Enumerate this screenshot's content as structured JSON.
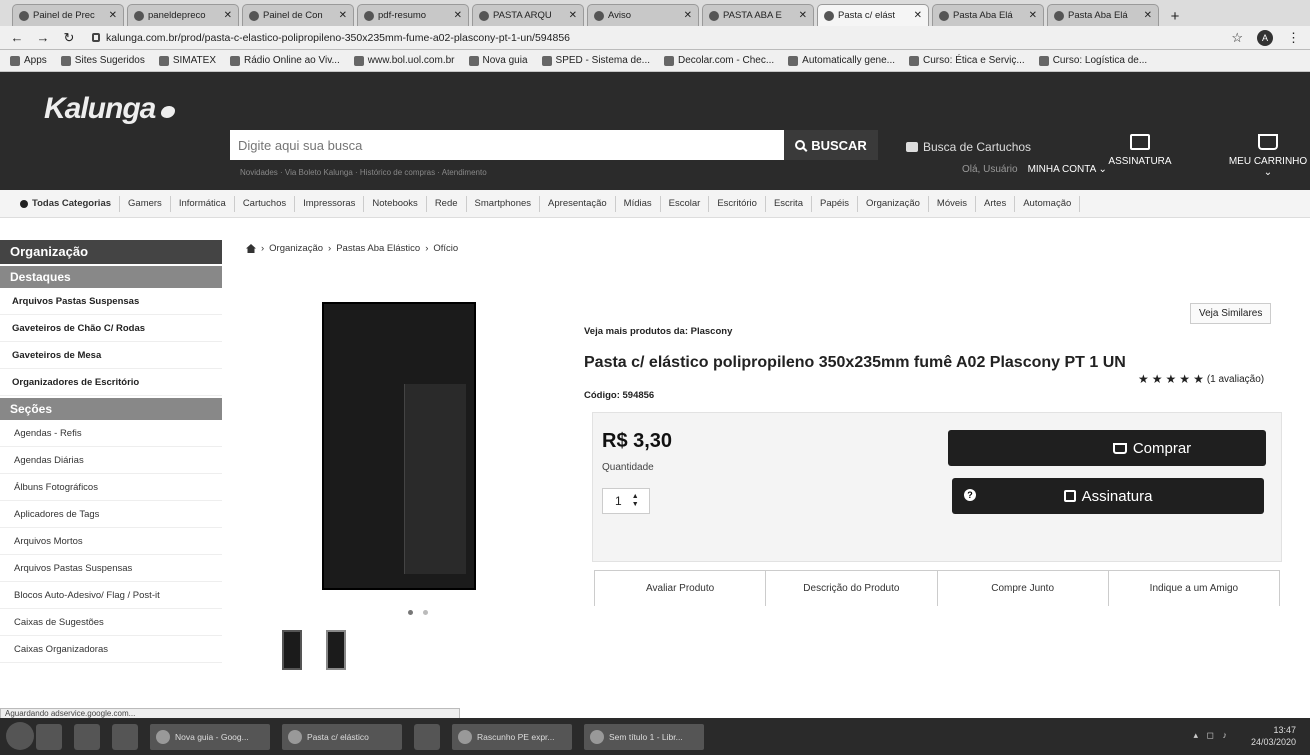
{
  "browser": {
    "tabs": [
      {
        "label": "Painel de Prec"
      },
      {
        "label": "paneldepreco"
      },
      {
        "label": "Painel de Con"
      },
      {
        "label": "pdf-resumo"
      },
      {
        "label": "PASTA ARQU"
      },
      {
        "label": "Aviso"
      },
      {
        "label": "PASTA ABA E"
      },
      {
        "label": "Pasta c/ elást",
        "active": true
      },
      {
        "label": "Pasta Aba Elá"
      },
      {
        "label": "Pasta Aba Elá"
      }
    ],
    "url": "kalunga.com.br/prod/pasta-c-elastico-polipropileno-350x235mm-fume-a02-plascony-pt-1-un/594856",
    "profile_initial": "A",
    "bookmarks": [
      "Apps",
      "Sites Sugeridos",
      "SIMATEX",
      "Rádio Online ao Viv...",
      "www.bol.uol.com.br",
      "Nova guia",
      "SPED - Sistema de...",
      "Decolar.com - Chec...",
      "Automatically gene...",
      "Curso: Ética e Serviç...",
      "Curso: Logística de..."
    ],
    "status_text": "Aguardando adservice.google.com..."
  },
  "site": {
    "logo": "Kalunga",
    "search_placeholder": "Digite aqui sua busca",
    "search_button": "BUSCAR",
    "quick_links": "Novidades · Via Boleto Kalunga · Histórico de compras · Atendimento",
    "cartridge_search": "Busca de Cartuchos",
    "greeting": "Olá, Usuário",
    "account": "MINHA CONTA",
    "subscription": "ASSINATURA",
    "cart": "MEU CARRINHO"
  },
  "categories": [
    "Todas Categorias",
    "Gamers",
    "Informática",
    "Cartuchos",
    "Impressoras",
    "Notebooks",
    "Rede",
    "Smartphones",
    "Apresentação",
    "Mídias",
    "Escolar",
    "Escritório",
    "Escrita",
    "Papéis",
    "Organização",
    "Móveis",
    "Artes",
    "Automação"
  ],
  "sidebar": {
    "title": "Organização",
    "highlights_title": "Destaques",
    "highlights": [
      "Arquivos Pastas Suspensas",
      "Gaveteiros de Chão C/ Rodas",
      "Gaveteiros de Mesa",
      "Organizadores de Escritório"
    ],
    "sections_title": "Seções",
    "sections": [
      "Agendas - Refis",
      "Agendas Diárias",
      "Álbuns Fotográficos",
      "Aplicadores de Tags",
      "Arquivos Mortos",
      "Arquivos Pastas Suspensas",
      "Blocos Auto-Adesivo/ Flag / Post-it",
      "Caixas de Sugestões",
      "Caixas Organizadoras"
    ]
  },
  "breadcrumb": [
    "Organização",
    "Pastas Aba Elástico",
    "Ofício"
  ],
  "product": {
    "see_more": "Veja mais produtos da: Plascony",
    "similar": "Veja Similares",
    "title": "Pasta c/ elástico polipropileno 350x235mm fumê A02 Plascony PT 1 UN",
    "rating_text": "(1 avaliação)",
    "rating": 5,
    "code": "Código: 594856",
    "price": "R$ 3,30",
    "quantity_label": "Quantidade",
    "quantity": "1",
    "buy_label": "Comprar",
    "subscribe_label": "Assinatura",
    "tabs": [
      "Avaliar Produto",
      "Descrição do Produto",
      "Compre Junto",
      "Indique a um Amigo"
    ]
  },
  "taskbar": {
    "windows": [
      "Nova guia - Goog...",
      "Pasta c/ elástico",
      "Rascunho PE expr...",
      "Sem título 1 - Libr..."
    ],
    "time": "13:47",
    "date": "24/03/2020"
  }
}
